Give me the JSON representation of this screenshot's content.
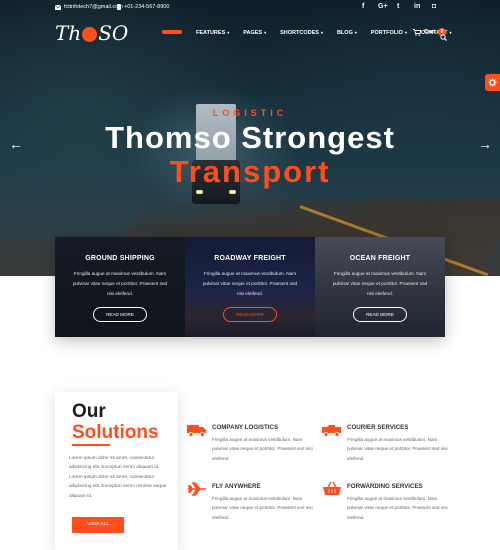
{
  "topbar": {
    "email": "fctinfotech7@gmail.com",
    "phone": "+01-234-567-8900",
    "social_icons": [
      "facebook-icon",
      "google-plus-icon",
      "twitter-icon",
      "linkedin-icon",
      "instagram-icon"
    ],
    "social_glyphs": [
      "f",
      "G+",
      "t",
      "in",
      "◘"
    ]
  },
  "brand": {
    "logo_text_before": "Th",
    "logo_text_after": "SO"
  },
  "nav": {
    "items": [
      {
        "label": "",
        "active": true
      },
      {
        "label": "FEATURES",
        "caret": "▾"
      },
      {
        "label": "PAGES",
        "caret": "▾"
      },
      {
        "label": "SHORTCODES",
        "caret": "▾"
      },
      {
        "label": "BLOG",
        "caret": "▾"
      },
      {
        "label": "PORTFOLIO",
        "caret": "▾"
      },
      {
        "label": "CONTACT",
        "caret": "▾"
      }
    ],
    "cart_label": "Cart",
    "cart_count": "0"
  },
  "hero": {
    "kicker": "LOGISTIC",
    "title_line1": "Thomso Strongest",
    "title_line2": "Transport",
    "prev_glyph": "←",
    "next_glyph": "→"
  },
  "cards": [
    {
      "title": "GROUND SHIPPING",
      "text": "Fringilla augue at maximus vestibulum. Nam pulvinar vitae neque et porttitor. Praesent sed nisi eleifend.",
      "button": "READ MORE"
    },
    {
      "title": "ROADWAY FREIGHT",
      "text": "Fringilla augue at maximus vestibulum. Nam pulvinar vitae neque et porttitor. Praesent sed nisi eleifend.",
      "button": "READ MORE"
    },
    {
      "title": "OCEAN FREIGHT",
      "text": "Fringilla augue at maximus vestibulum. Nam pulvinar vitae neque et porttitor. Praesent sed nisi eleifend.",
      "button": "READ MORE"
    }
  ],
  "solutions": {
    "title_line1": "Our",
    "title_line2": "Solutions",
    "text": "Lorem ipsum dolor sit amet, consectetur adipisicing elit. Excepturi nemo aliquam id. Lorem ipsum dolor sit amet, consectetur adipisicing elit. Excepturi nemo minima eaque aliquam id.",
    "button": "VIEW ALL"
  },
  "features": [
    {
      "title": "COMPANY LOGISTICS",
      "icon": "truck-icon",
      "text": "Fringilla augue at maximus vestibulum. Nam pulvinar vitae neque et porttitor. Praesent sed nisi eleifend."
    },
    {
      "title": "COURIER SERVICES",
      "icon": "courier-truck-icon",
      "text": "Fringilla augue at maximus vestibulum. Nam pulvinar vitae neque et porttitor. Praesent sed nisi eleifend."
    },
    {
      "title": "FLY ANYWHERE",
      "icon": "airplane-icon",
      "text": "Fringilla augue at maximus vestibulum. Nam pulvinar vitae neque et porttitor. Praesent sed nisi eleifend."
    },
    {
      "title": "FORWARDING SERVICES",
      "icon": "basket-icon",
      "text": "Fringilla augue at maximus vestibulum. Nam pulvinar vitae neque et porttitor. Praesent sed nisi eleifend."
    }
  ],
  "colors": {
    "accent": "#ff4e1a",
    "dark": "#1c1c1c"
  }
}
